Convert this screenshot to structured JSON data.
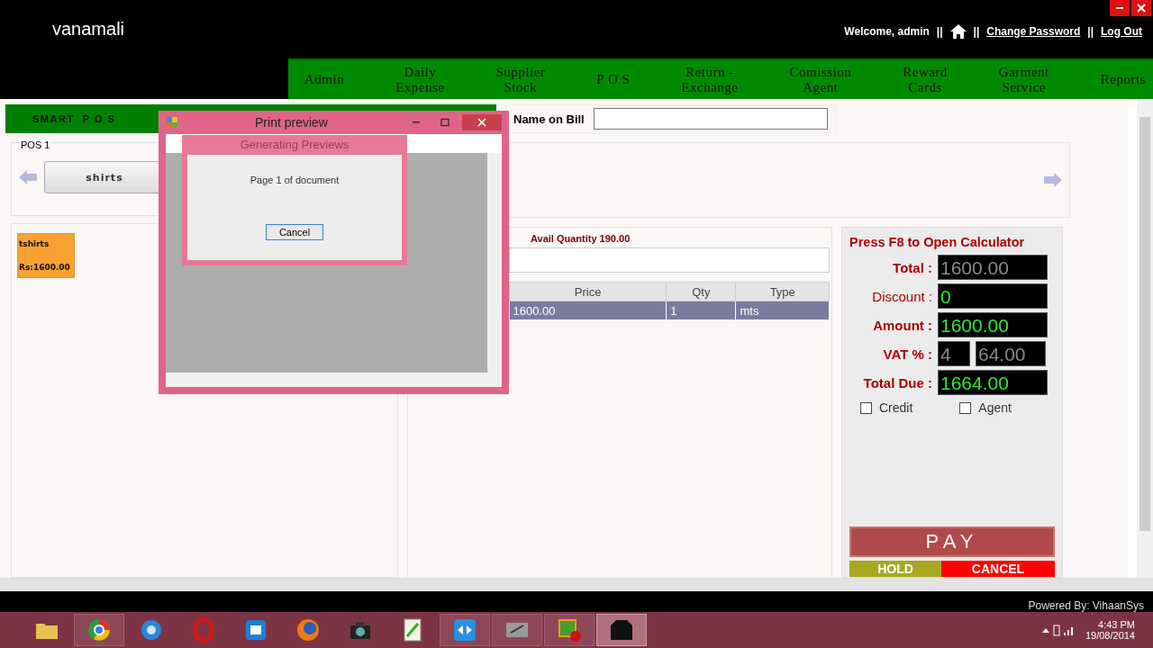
{
  "header": {
    "logo": "vanamali",
    "welcome": "Welcome, admin",
    "separators": [
      "||",
      "||",
      "||"
    ],
    "links": [
      "Change Password",
      "Log Out"
    ]
  },
  "nav": [
    "Admin",
    "Daily\nExpense",
    "Supplier\nStock",
    "P O S",
    "Return -\nExchange",
    "Comission\nAgent",
    "Reward\nCards",
    "Garment\nService",
    "Reports"
  ],
  "pos": {
    "title": "SMART  P O S",
    "group": "POS 1",
    "categories": [
      "shirts"
    ],
    "products": [
      {
        "name": "tshirts",
        "price": "Rs:1600.00"
      }
    ]
  },
  "bill": {
    "label": "Name on Bill"
  },
  "item": {
    "avail": "Avail Quantity 190.00",
    "columns": [
      "Price",
      "Qty",
      "Type"
    ],
    "rows": [
      {
        "cells": [
          "1600.00",
          "1",
          "mts"
        ],
        "selected": true
      }
    ]
  },
  "calculator": {
    "heading": "Press F8 to Open Calculator",
    "fields": [
      {
        "label": "Total :",
        "values": [
          "1600.00"
        ],
        "bold": true,
        "readonly": true
      },
      {
        "label": "Discount :",
        "values": [
          "0"
        ],
        "bold": false,
        "readonly": false
      },
      {
        "label": "Amount :",
        "values": [
          "1600.00"
        ],
        "bold": true,
        "readonly": false
      },
      {
        "label": "VAT % :",
        "values": [
          "4",
          "64.00"
        ],
        "bold": true,
        "readonly": true
      },
      {
        "label": "Total Due :",
        "values": [
          "1664.00"
        ],
        "bold": true,
        "readonly": false
      }
    ],
    "checkboxes": [
      {
        "label": "Credit",
        "checked": false
      },
      {
        "label": "Agent",
        "checked": false
      }
    ],
    "buttons": [
      {
        "label": "PAY",
        "kind": "pay"
      },
      {
        "label": "HOLD",
        "kind": "hold"
      },
      {
        "label": "CANCEL",
        "kind": "cancel"
      }
    ]
  },
  "dialog": {
    "title": "Print preview",
    "progress": {
      "title": "Generating Previews",
      "message": "Page 1 of document",
      "button": "Cancel"
    }
  },
  "footer": "Powered By: VihaanSys",
  "taskbar": {
    "apps": [
      {
        "running": false,
        "selected": false
      },
      {
        "running": true,
        "selected": false
      },
      {
        "running": false,
        "selected": false
      },
      {
        "running": false,
        "selected": false
      },
      {
        "running": false,
        "selected": false
      },
      {
        "running": false,
        "selected": false
      },
      {
        "running": false,
        "selected": false
      },
      {
        "running": false,
        "selected": false
      },
      {
        "running": true,
        "selected": false
      },
      {
        "running": true,
        "selected": false
      },
      {
        "running": true,
        "selected": false
      },
      {
        "running": true,
        "selected": true
      }
    ],
    "time": "4:43 PM",
    "date": "19/08/2014"
  }
}
